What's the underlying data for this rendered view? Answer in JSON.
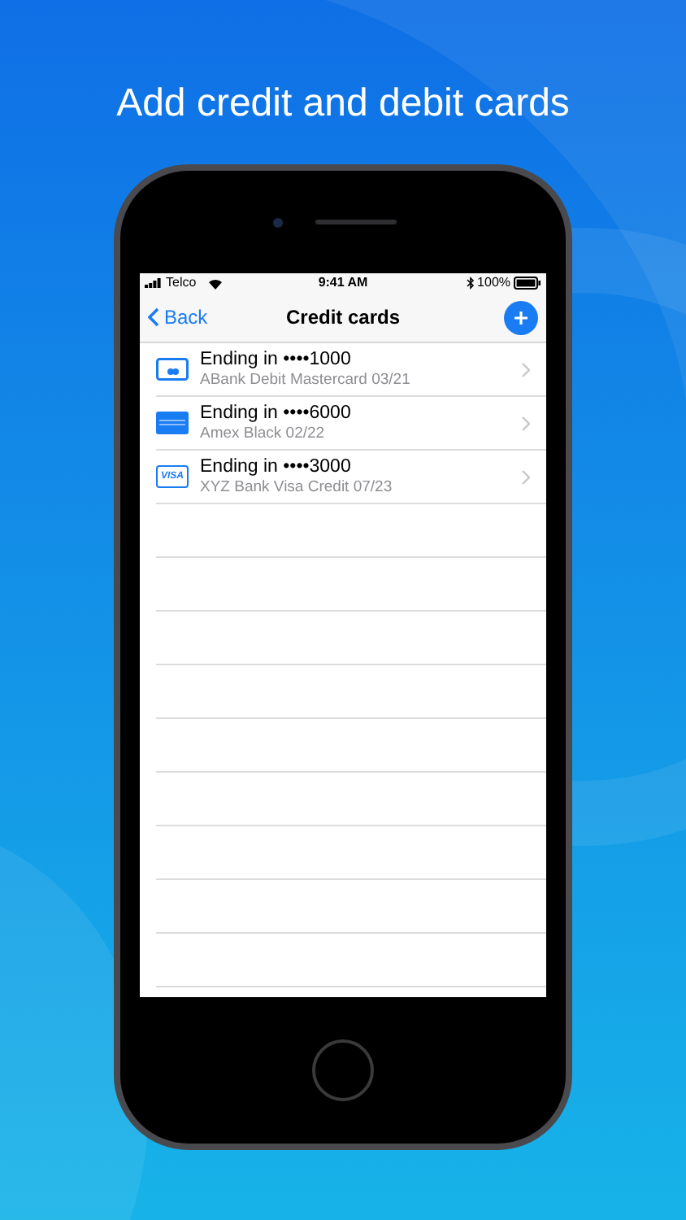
{
  "headline": "Add credit and debit cards",
  "status_bar": {
    "carrier": "Telco",
    "time": "9:41 AM",
    "battery": "100%"
  },
  "nav_bar": {
    "back": "Back",
    "title": "Credit cards"
  },
  "cards": [
    {
      "kind": "mastercard",
      "title": "Ending in ••••1000",
      "subtitle": "ABank Debit Mastercard 03/21"
    },
    {
      "kind": "amex",
      "title": "Ending in ••••6000",
      "subtitle": "Amex Black 02/22"
    },
    {
      "kind": "visa",
      "brand_label": "VISA",
      "title": "Ending in ••••3000",
      "subtitle": "XYZ Bank Visa Credit 07/23"
    }
  ]
}
